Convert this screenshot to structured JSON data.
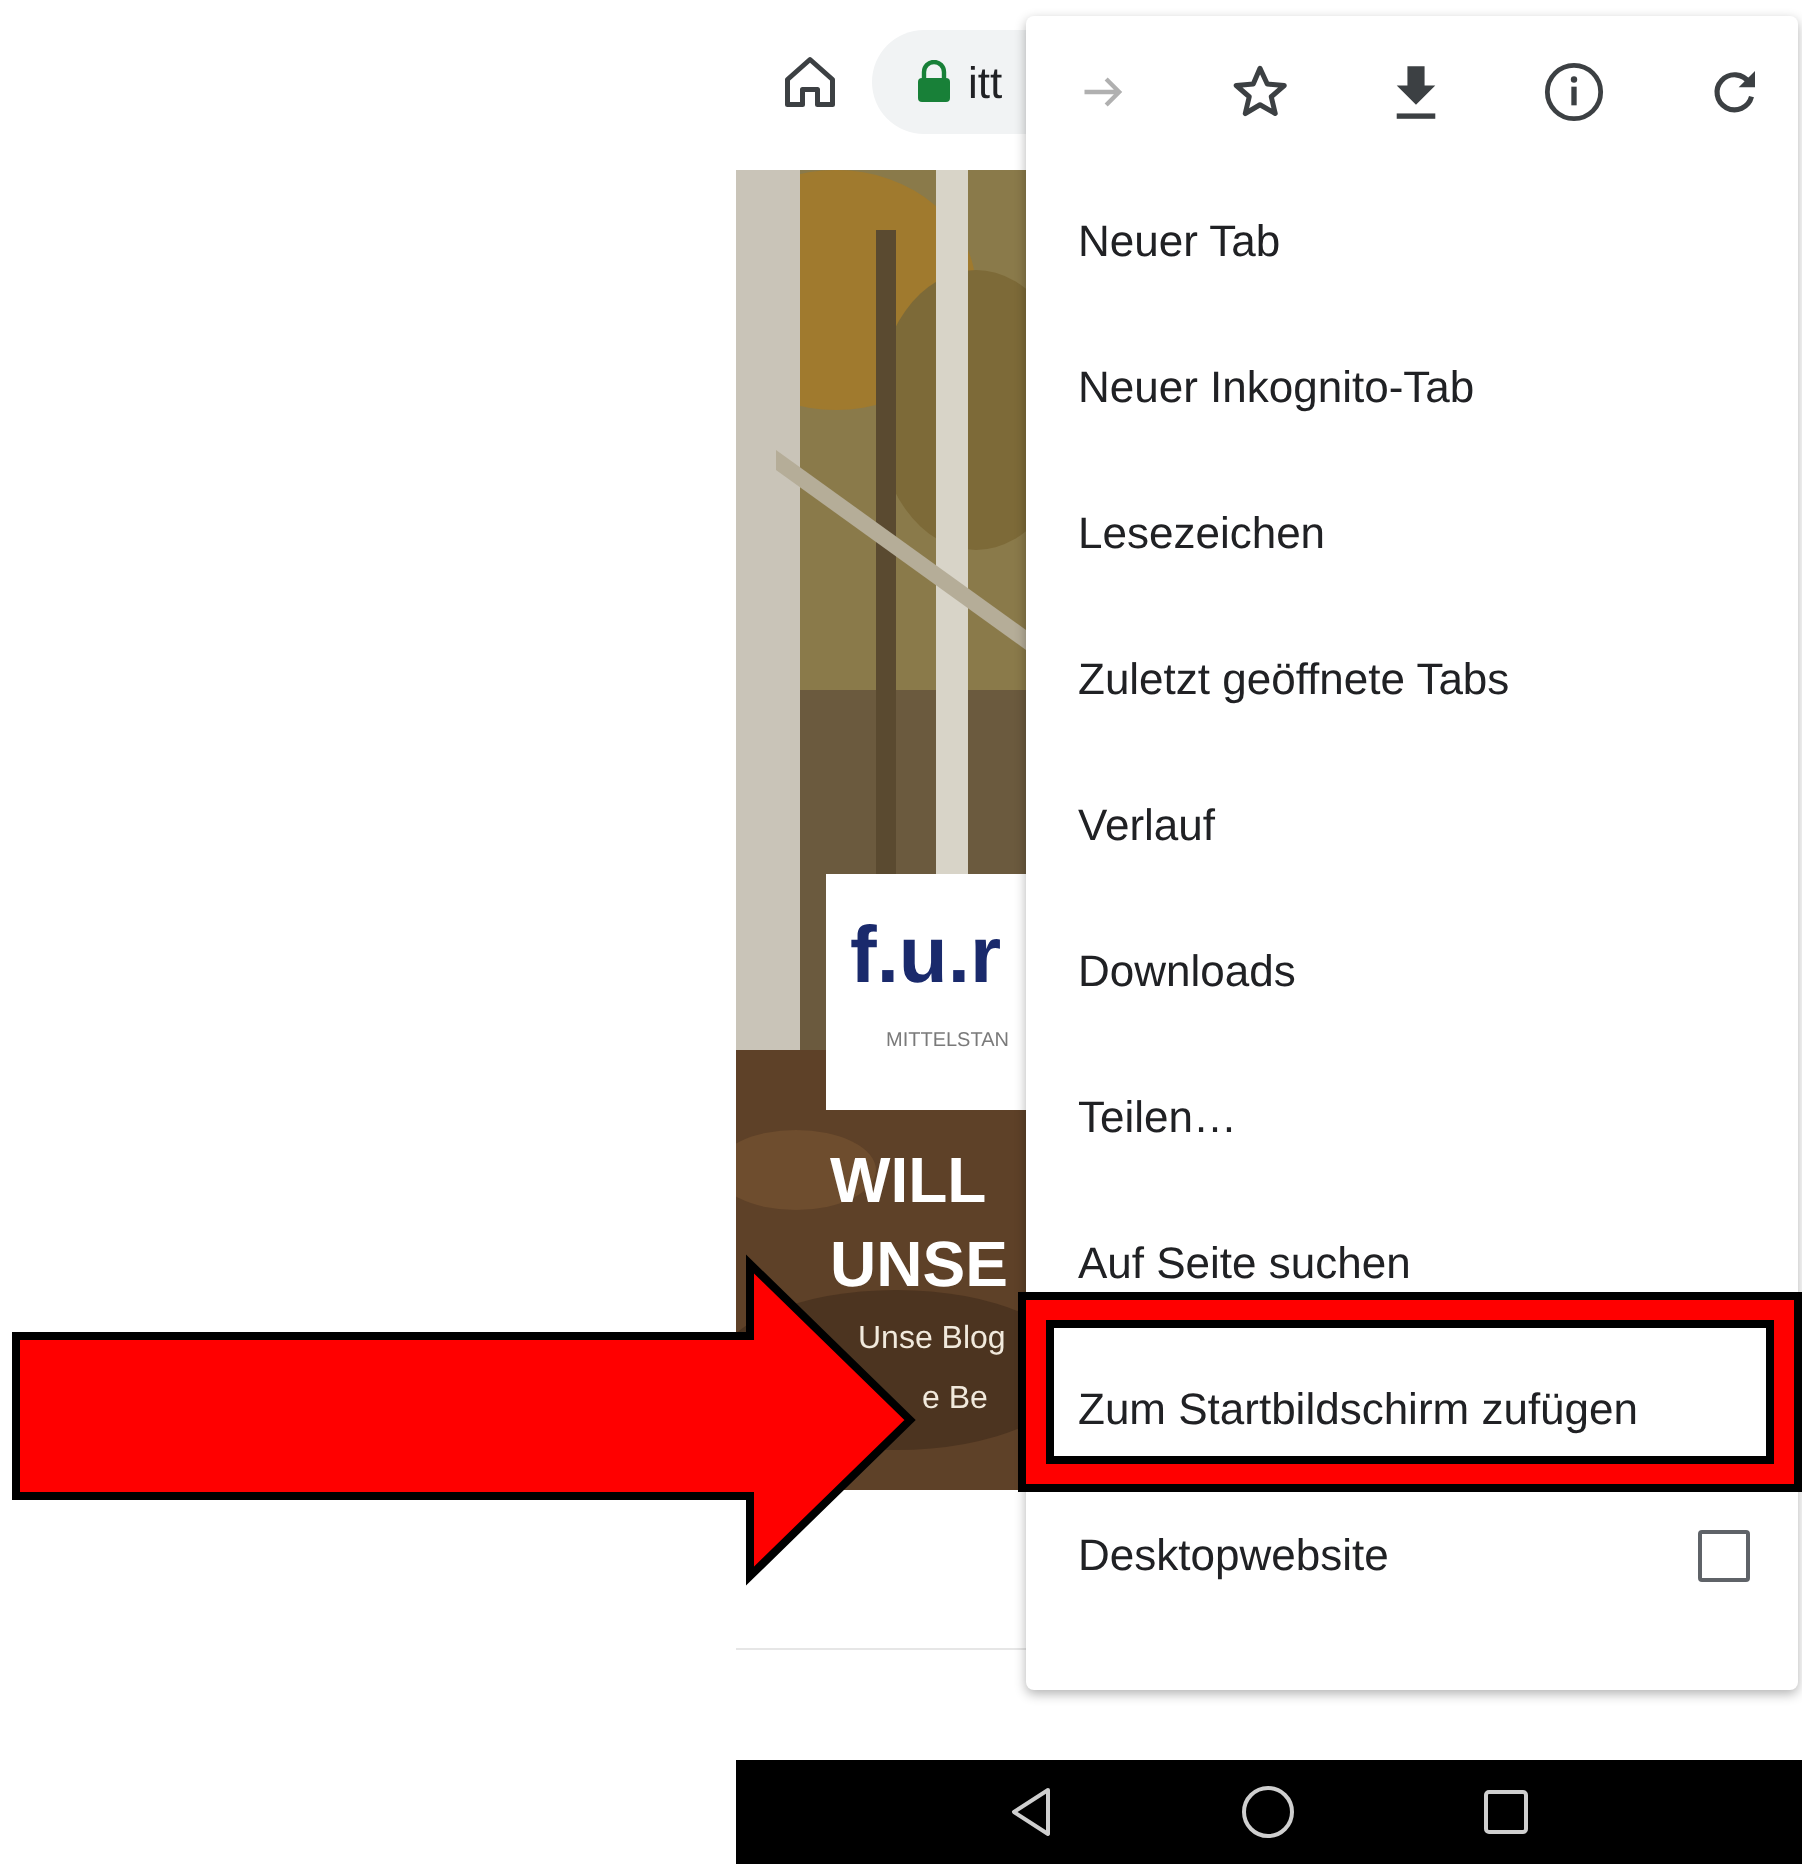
{
  "toolbar": {
    "url": "itt"
  },
  "page": {
    "logo": "f.u.r",
    "logo_subtitle": "MITTELSTAN",
    "headline": [
      "WILL",
      "UNSE"
    ],
    "subline": [
      "Unse Blog",
      "e Be"
    ]
  },
  "menu": {
    "actions": [
      {
        "kind": "forward",
        "disabled": true
      },
      {
        "kind": "bookmark",
        "disabled": false
      },
      {
        "kind": "download",
        "disabled": false
      },
      {
        "kind": "info",
        "disabled": false
      },
      {
        "kind": "reload",
        "disabled": false
      }
    ],
    "items": [
      {
        "kind": "plain",
        "label": "Neuer Tab",
        "annotated": false
      },
      {
        "kind": "plain",
        "label": "Neuer Inkognito-Tab",
        "annotated": false
      },
      {
        "kind": "plain",
        "label": "Lesezeichen",
        "annotated": false
      },
      {
        "kind": "plain",
        "label": "Zuletzt geöffnete Tabs",
        "annotated": false
      },
      {
        "kind": "plain",
        "label": "Verlauf",
        "annotated": false
      },
      {
        "kind": "plain",
        "label": "Downloads",
        "annotated": false
      },
      {
        "kind": "plain",
        "label": "Teilen…",
        "annotated": false
      },
      {
        "kind": "plain",
        "label": "Auf Seite suchen",
        "annotated": false
      },
      {
        "kind": "plain",
        "label": "Zum Startbildschirm zufügen",
        "annotated": true
      },
      {
        "kind": "checkbox",
        "label": "Desktopwebsite",
        "checked": false,
        "annotated": false
      }
    ]
  }
}
